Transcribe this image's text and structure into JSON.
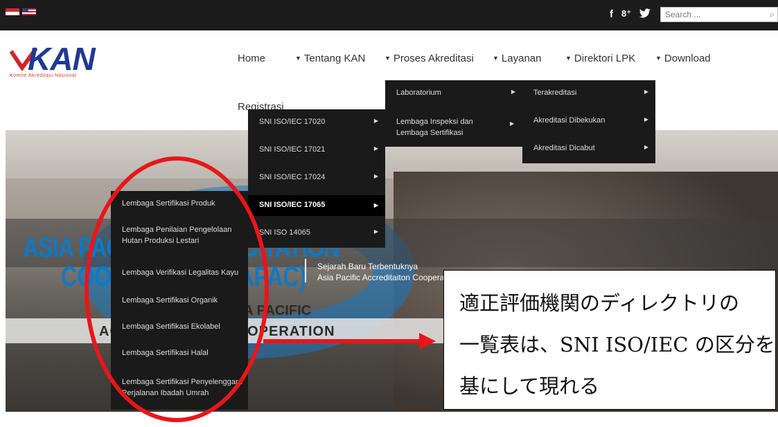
{
  "topbar": {
    "social": [
      "f",
      "8⁺",
      "🐦"
    ],
    "search_placeholder": "Search ...",
    "search_icon": "search-icon"
  },
  "logo": {
    "text": "KAN",
    "subtitle": "Komite Akreditasi Nasional"
  },
  "nav": {
    "home": "Home",
    "items": [
      "Tentang KAN",
      "Proses Akreditasi",
      "Layanan",
      "Direktori LPK",
      "Download"
    ],
    "registrasi": "Registrasi"
  },
  "menu_lpk": {
    "items": [
      "Laboratorium",
      "Lembaga Inspeksi dan Lembaga Sertifikasi"
    ]
  },
  "menu_status": {
    "items": [
      "Terakreditasi",
      "Akreditasi Dibekukan",
      "Akreditasi Dicabut"
    ]
  },
  "menu_sni": {
    "items": [
      "SNI ISO/IEC 17020",
      "SNI ISO/IEC 17021",
      "SNI ISO/IEC 17024",
      "SNI ISO/IEC 17065",
      "SNI ISO 14065"
    ]
  },
  "menu_lembaga": {
    "items": [
      "Lembaga Sertifikasi Produk",
      "Lembaga Penilaian Pengelolaan Hutan Produksi Lestari",
      "Lembaga Verifikasi Legalitas Kayu",
      "Lembaga Sertifikasi Organik",
      "Lembaga Sertifikasi Ekolabel",
      "Lembaga Sertifikasi Halal",
      "Lembaga Sertifikasi Penyelenggara Perjalanan Ibadah Umrah"
    ]
  },
  "hero": {
    "apac_line1": "ASIA PACIFIC ACCREDITATION",
    "apac_line2": "COOPERATION (APAC)",
    "apac_small1": "ASIA PACIFIC",
    "apac_small2": "ACCREDITATION COOPERATION",
    "sejarah1": "Sejarah Baru Terbentuknya",
    "sejarah2": "Asia Pacific Accreditaiton Cooperation"
  },
  "annotation": {
    "line1": "適正評価機関のディレクトリの",
    "line2": "一覧表は、SNI ISO/IEC の区分を",
    "line3": "基にして現れる",
    "color": "#e8161a"
  }
}
